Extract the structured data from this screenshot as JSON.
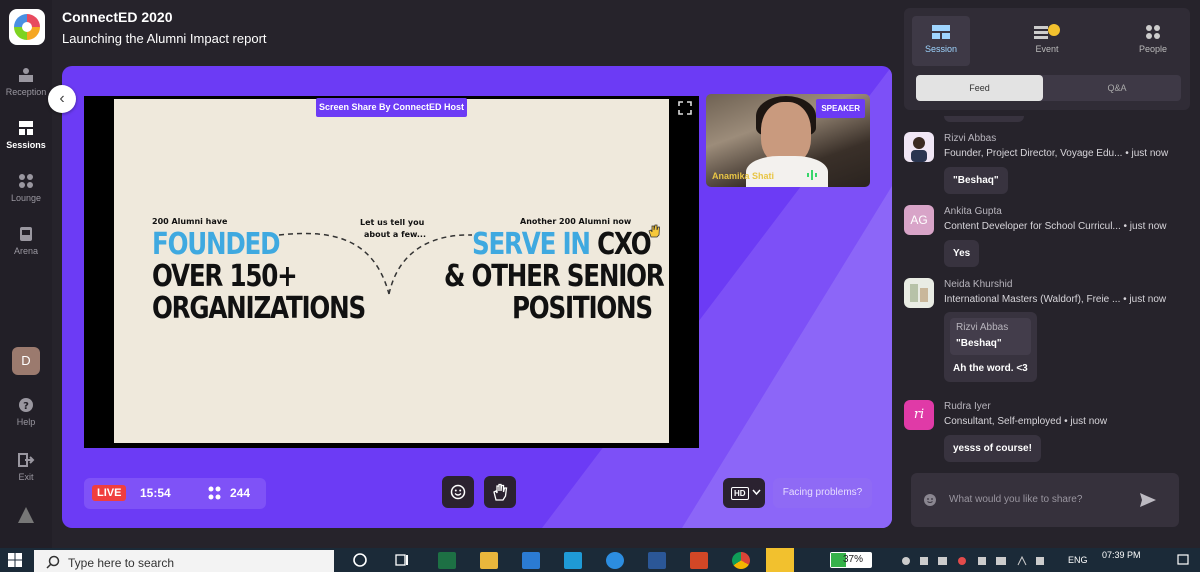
{
  "app": {
    "title": "ConnectED 2020",
    "subtitle": "Launching the Alumni Impact report"
  },
  "sidebar": {
    "items": [
      {
        "label": "Reception",
        "icon": "reception-icon"
      },
      {
        "label": "Sessions",
        "icon": "sessions-icon",
        "active": true
      },
      {
        "label": "Lounge",
        "icon": "lounge-icon"
      },
      {
        "label": "Arena",
        "icon": "arena-icon"
      }
    ],
    "user_initial": "D",
    "help_label": "Help",
    "exit_label": "Exit"
  },
  "stage": {
    "share_label": "Screen Share By ConnectED Host",
    "speaker_tag": "SPEAKER",
    "speaker_name": "Anamika Shati",
    "slide": {
      "left_caption": "200 Alumni have",
      "left_line1": "FOUNDED",
      "left_line2": "OVER 150+",
      "left_line3": "ORGANIZATIONS",
      "mid_caption_1": "Let us tell you",
      "mid_caption_2": "about a few...",
      "right_caption": "Another 200 Alumni now",
      "right_line1a": "SERVE IN",
      "right_line1b": " CXO",
      "right_line2": "& OTHER SENIOR",
      "right_line3": "POSITIONS"
    },
    "live_label": "LIVE",
    "timer": "15:54",
    "attendee_count": "244",
    "hd_label": "HD",
    "problems_label": "Facing problems?"
  },
  "right_panel": {
    "tabs": [
      {
        "label": "Session",
        "active": true
      },
      {
        "label": "Event"
      },
      {
        "label": "People"
      }
    ],
    "feed_tab": "Feed",
    "qa_tab": "Q&A",
    "messages": [
      {
        "name": "Rizvi Abbas",
        "sub": "Founder, Project Director, Voyage Edu...",
        "time": "• just now",
        "bubble": "\"Beshaq\""
      },
      {
        "name": "Ankita Gupta",
        "initials": "AG",
        "sub": "Content Developer for School Curricul...",
        "time": "• just now",
        "bubble": "Yes"
      },
      {
        "name": "Neida Khurshid",
        "sub": "International Masters (Waldorf), Freie ...",
        "time": "• just now",
        "quote_name": "Rizvi Abbas",
        "quote_text": "\"Beshaq\"",
        "bubble": "Ah the word. <3"
      },
      {
        "name": "Rudra Iyer",
        "sub": "Consultant, Self-employed",
        "time": "• just now",
        "bubble": "yesss of course!"
      }
    ],
    "composer_placeholder": "What would you like to share?"
  },
  "taskbar": {
    "search_placeholder": "Type here to search",
    "battery": "37%",
    "language": "ENG",
    "time": "07:39 PM"
  },
  "colors": {
    "stage": "#6c3bf5",
    "live": "#f03e3e",
    "accent_blue": "#3fa9e0"
  }
}
